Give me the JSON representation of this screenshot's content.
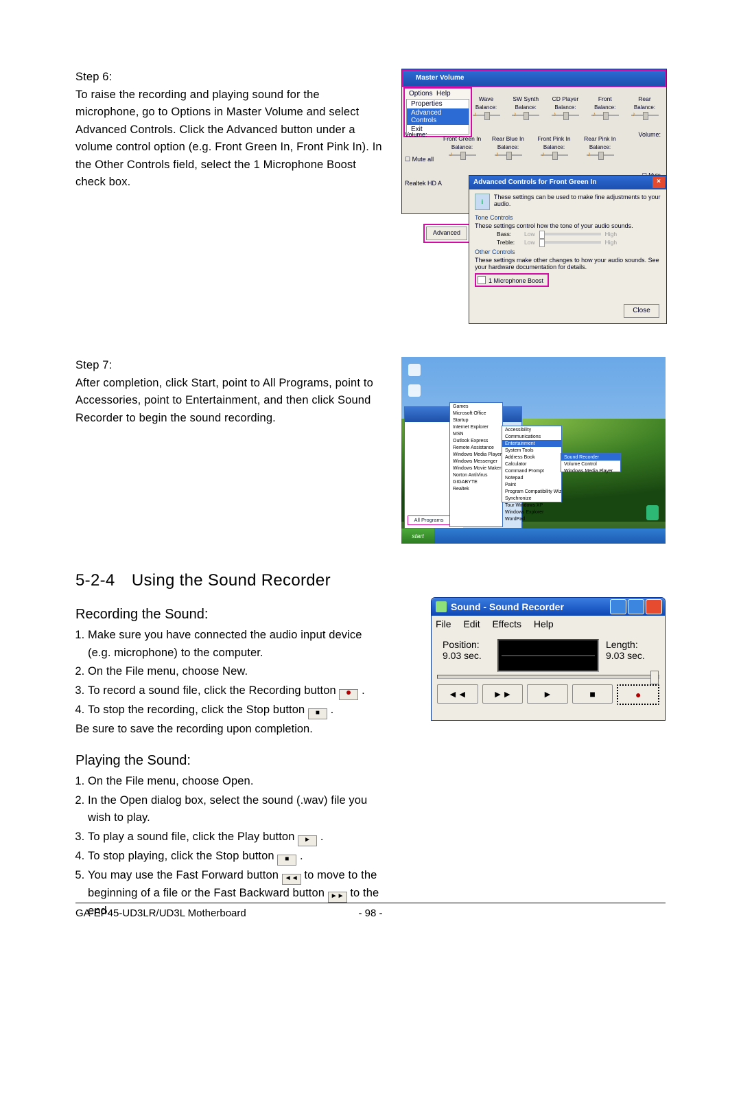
{
  "step6": {
    "label": "Step 6:",
    "body": "To raise the recording and playing sound for the microphone, go to Options in Master Volume and select Advanced Controls. Click the Advanced button under a volume control option (e.g. Front Green In, Front Pink In). In the Other Controls field, select the 1 Microphone Boost check box."
  },
  "step7": {
    "label": "Step 7:",
    "body": "After completion, click Start, point to All Programs, point to Accessories, point to Entertainment, and then click Sound Recorder to begin the sound recording."
  },
  "section": {
    "number_title": "5-2-4 Using the Sound Recorder",
    "recording_title": "Recording the Sound:",
    "playing_title": "Playing the Sound:"
  },
  "recording": {
    "i1": "Make sure you have connected the audio input device (e.g. microphone) to the computer.",
    "i2_a": "On the ",
    "i2_b": "File",
    "i2_c": " menu, choose ",
    "i2_d": "New",
    "i2_e": ".",
    "i3_a": "To record a sound file, click the ",
    "i3_b": "Recording",
    "i3_c": " button ",
    "i4_a": "To stop the recording, click the ",
    "i4_b": "Stop",
    "i4_c": " button ",
    "note": "Be sure to save the recording upon completion."
  },
  "playing": {
    "i1_a": "On the ",
    "i1_b": "File",
    "i1_c": " menu, choose ",
    "i1_d": "Open",
    "i1_e": ".",
    "i2": "In the Open dialog box, select the sound (.wav) file you wish to play.",
    "i3_a": "To play a sound file, click the ",
    "i3_b": "Play",
    "i3_c": " button ",
    "i4_a": "To stop playing, click the ",
    "i4_b": "Stop",
    "i4_c": " button ",
    "i5_a": "You may use the ",
    "i5_b": "Fast Forward",
    "i5_c": " button ",
    "i5_d": " to move to the beginning of a file or the ",
    "i5_e": "Fast Backward",
    "i5_f": " button ",
    "i5_g": " to the end."
  },
  "footer": {
    "left": "GA-EP45-UD3LR/UD3L Motherboard",
    "mid": "- 98 -"
  },
  "fig1": {
    "title": "Master Volume",
    "options": "Options",
    "help": "Help",
    "dd1": "Properties",
    "dd2": "Advanced Controls",
    "dd3": "Exit",
    "cols_top": [
      "Wave",
      "SW Synth",
      "CD Player",
      "Front",
      "Rear"
    ],
    "balance": "Balance:",
    "left_lbls": [
      "Volume:",
      "Mute all",
      "Realtek HD A"
    ],
    "cols_mid": [
      "Front Green In",
      "Rear Blue In",
      "Front Pink In",
      "Rear Pink In"
    ],
    "volume_rt": "Volume:",
    "mute": "Mute",
    "adv_btn": "Advanced",
    "ac_title": "Advanced Controls for Front Green In",
    "ac_intro": "These settings can be used to make fine adjustments to your audio.",
    "tone_t": "Tone Controls",
    "tone_d": "These settings control how the tone of your audio sounds.",
    "bass": "Bass:",
    "treble": "Treble:",
    "low": "Low",
    "high": "High",
    "other_t": "Other Controls",
    "other_d": "These settings make other changes to how your audio sounds. See your hardware documentation for details.",
    "chk": "1  Microphone Boost",
    "close": "Close"
  },
  "fig2": {
    "start": "start",
    "allprograms": "All Programs",
    "fo1": [
      "Games",
      "Microsoft Office",
      "Startup",
      "Internet Explorer",
      "MSN",
      "Outlook Express",
      "Remote Assistance",
      "Windows Media Player",
      "Windows Messenger",
      "Windows Movie Maker",
      "Norton AntiVirus",
      "GIGABYTE",
      "Realtek"
    ],
    "fo2": [
      "Accessibility",
      "Communications",
      "Entertainment",
      "System Tools",
      "Address Book",
      "Calculator",
      "Command Prompt",
      "Notepad",
      "Paint",
      "Program Compatibility Wizard",
      "Synchronize",
      "Tour Windows XP",
      "Windows Explorer",
      "WordPad"
    ],
    "fo2_hi_index": 2,
    "fo3": [
      "Sound Recorder",
      "Volume Control",
      "Windows Media Player"
    ],
    "fo3_hi_index": 0
  },
  "fig3": {
    "title": "Sound - Sound Recorder",
    "menu": {
      "file": "File",
      "edit": "Edit",
      "effects": "Effects",
      "help": "Help"
    },
    "pos_l": "Position:",
    "pos_v": "9.03 sec.",
    "len_l": "Length:",
    "len_v": "9.03 sec.",
    "symbols": {
      "rew": "◄◄",
      "ffw": "►►",
      "play": "►",
      "stop": "■",
      "rec": "●"
    }
  }
}
